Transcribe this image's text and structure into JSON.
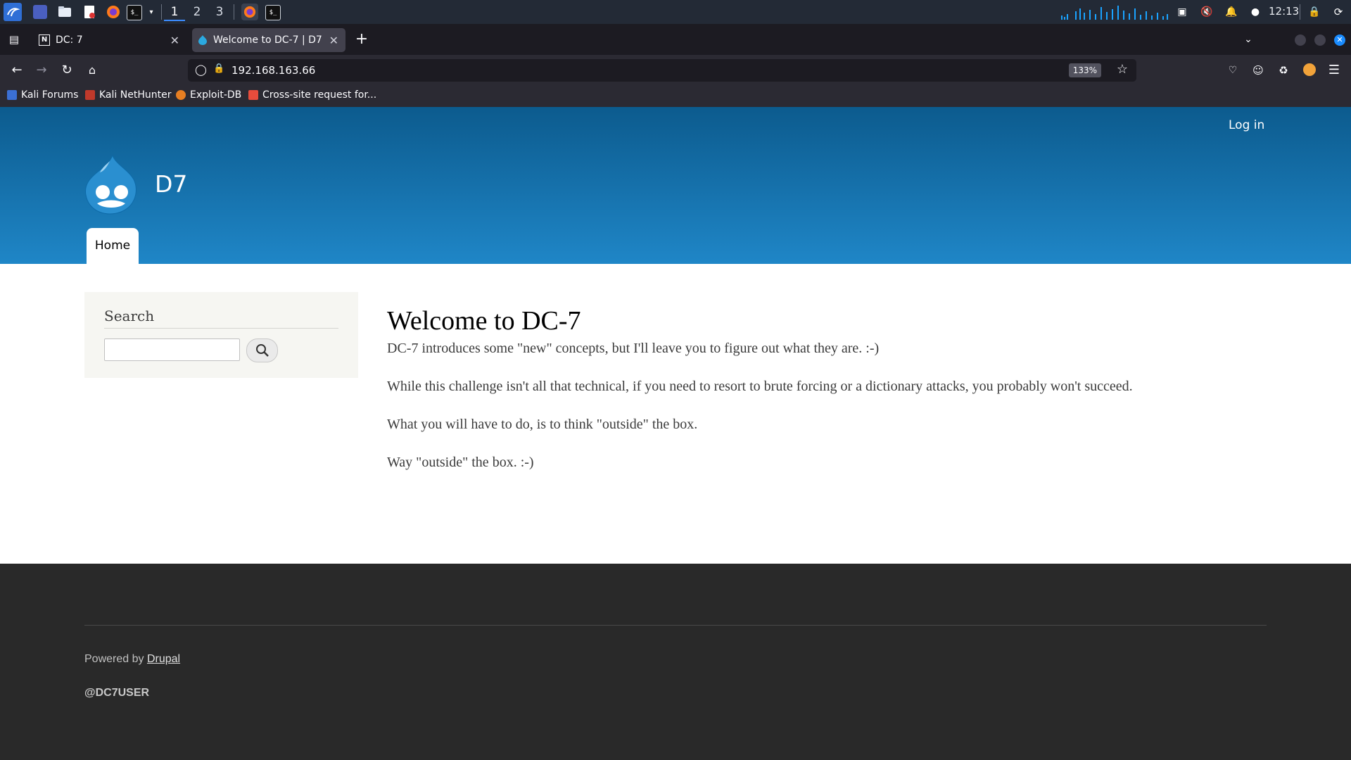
{
  "taskbar": {
    "workspaces": [
      "1",
      "2",
      "3"
    ],
    "active_workspace": "1",
    "clock": "12:13"
  },
  "browser": {
    "tabs": [
      {
        "title": "DC: 7",
        "active": false
      },
      {
        "title": "Welcome to DC-7 | D7",
        "active": true
      }
    ],
    "url": "192.168.163.66",
    "zoom": "133%",
    "bookmarks": [
      "Kali Forums",
      "Kali NetHunter",
      "Exploit-DB",
      "Cross-site request for..."
    ]
  },
  "site": {
    "login_link": "Log in",
    "site_name": "D7",
    "nav": {
      "home": "Home"
    },
    "search": {
      "heading": "Search",
      "value": ""
    },
    "content": {
      "title": "Welcome to DC-7",
      "paragraphs": [
        "DC-7 introduces some \"new\" concepts, but I'll leave you to figure out what they are.  :-)",
        "While this challenge isn't all that technical, if you need to resort to brute forcing or a dictionary attacks, you probably won't succeed.",
        "What you will have to do, is to think \"outside\" the box.",
        "Way \"outside\" the box.  :-)"
      ]
    },
    "footer": {
      "powered_prefix": "Powered by ",
      "powered_link": "Drupal",
      "user": "@DC7USER"
    }
  },
  "colors": {
    "header_top": "#0c5b8e",
    "header_bottom": "#1f86c7",
    "footer_bg": "#292929",
    "taskbar_bg": "#232a36"
  }
}
